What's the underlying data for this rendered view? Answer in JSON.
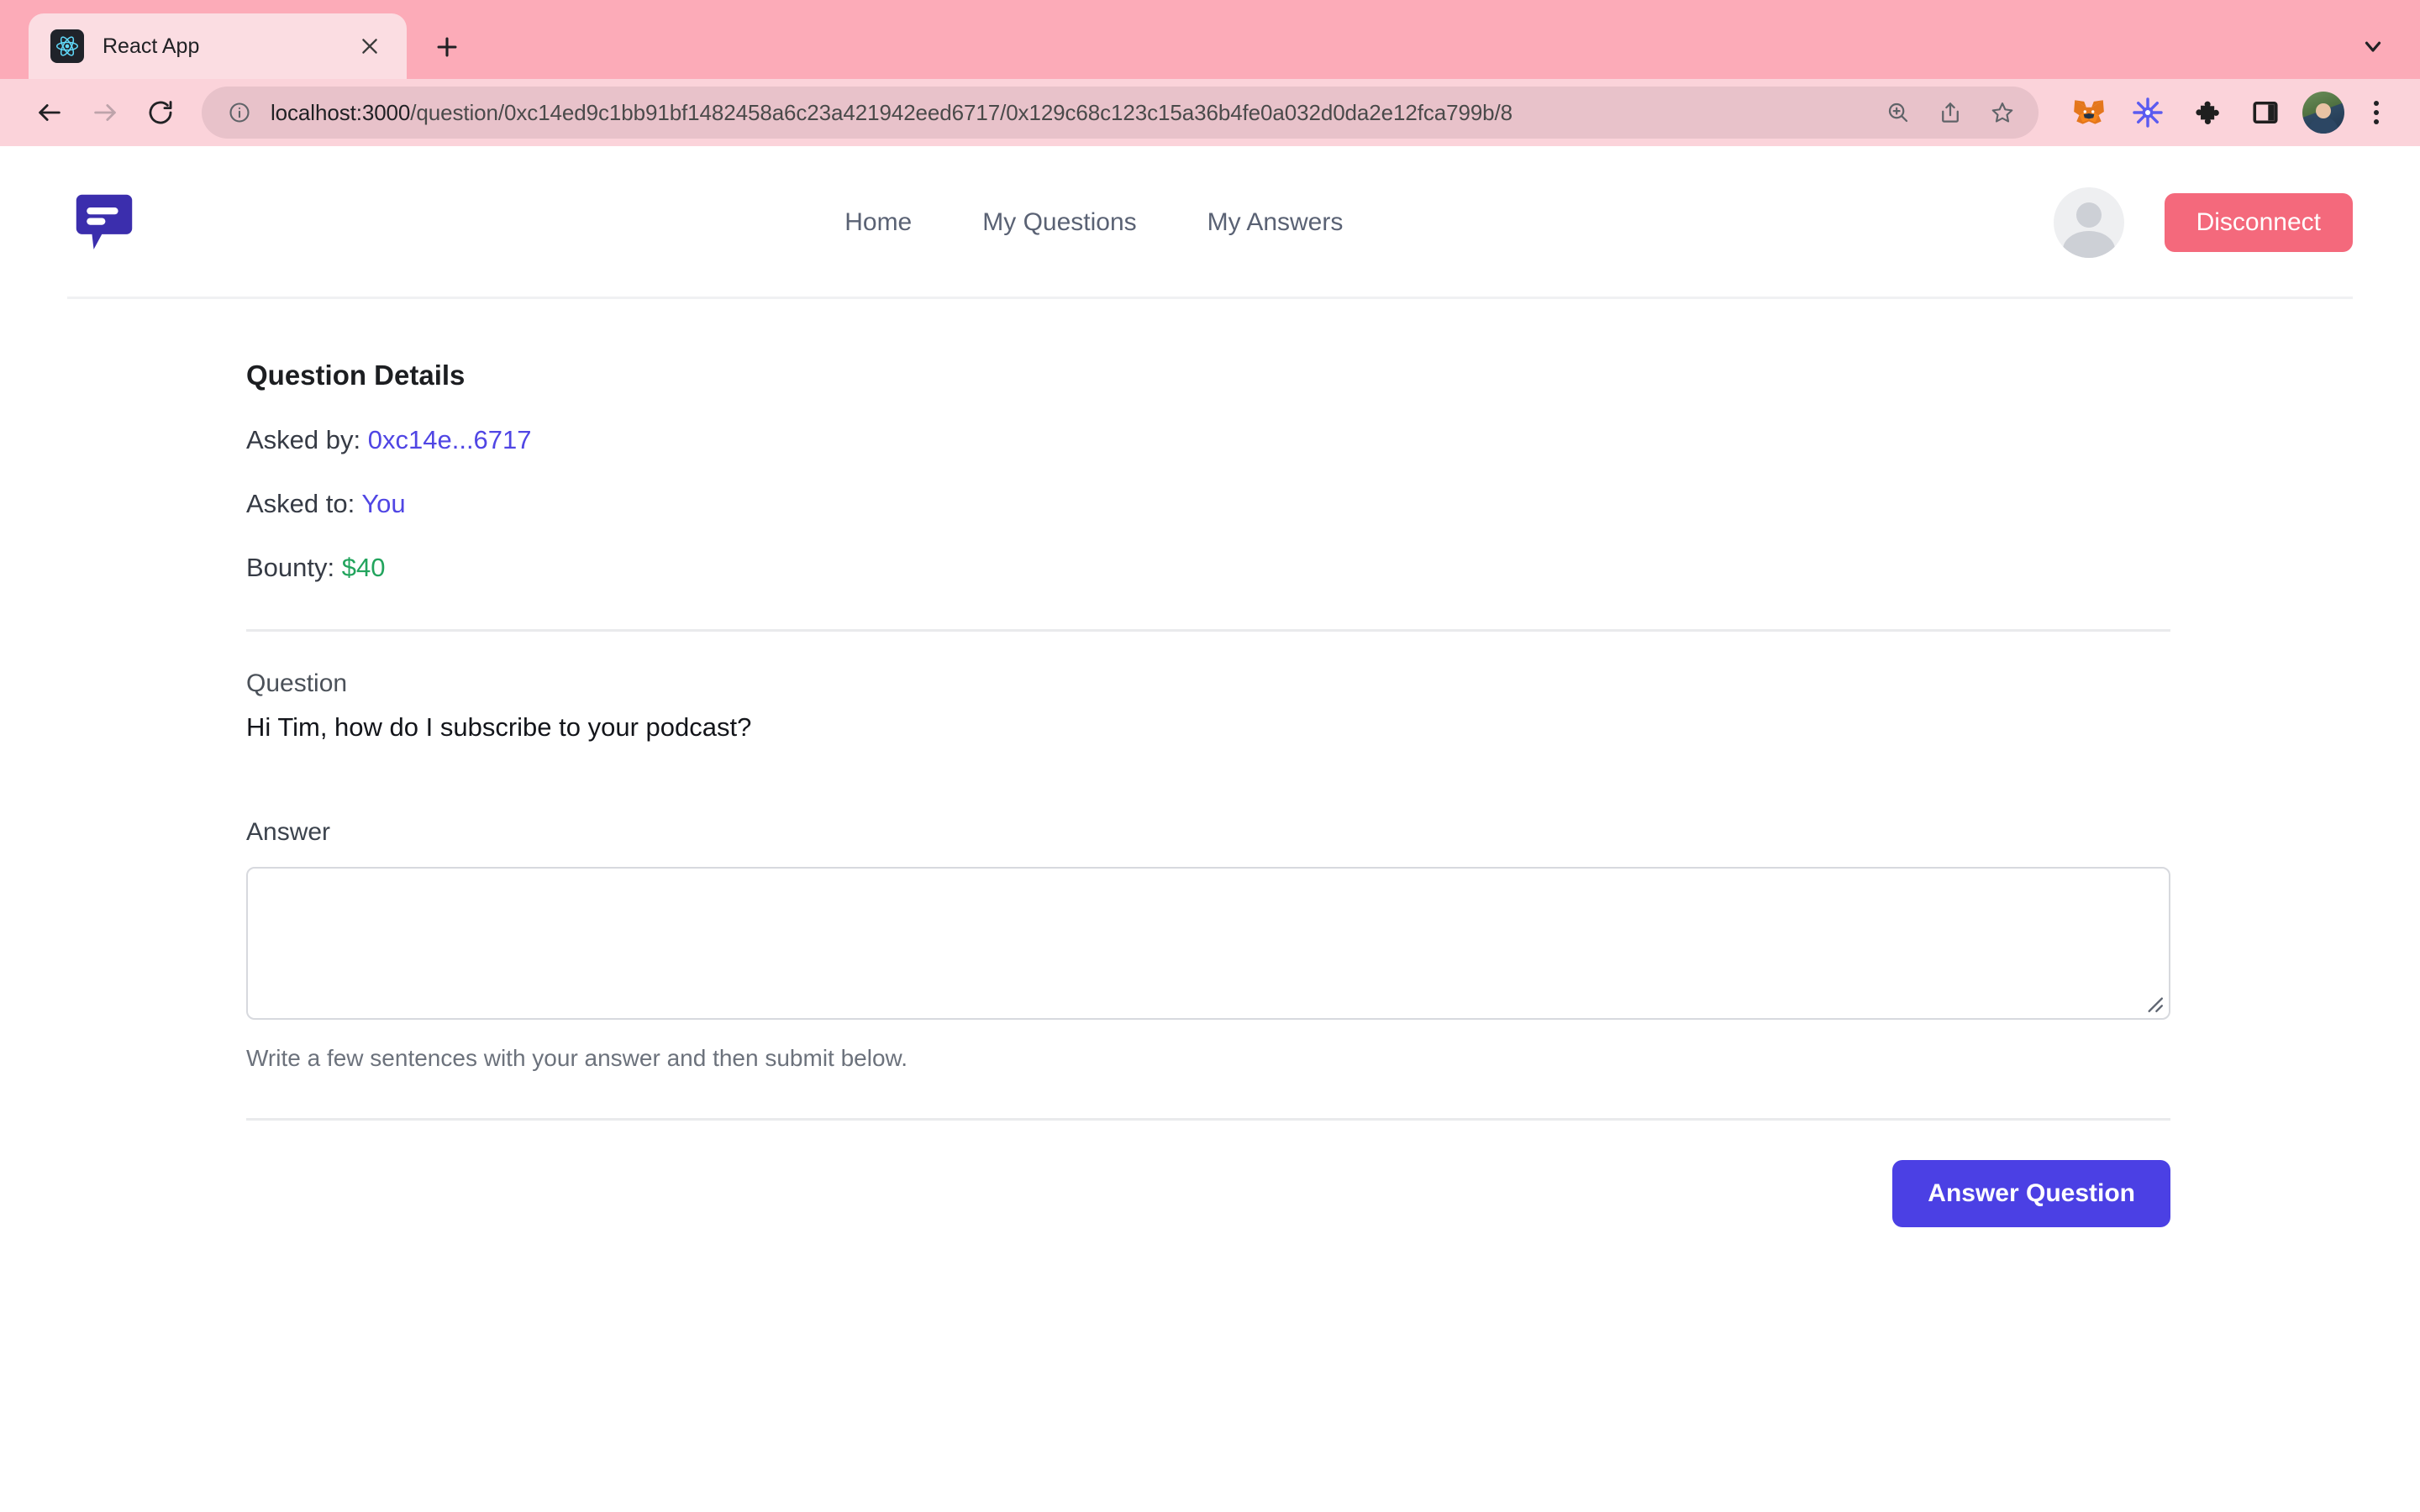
{
  "browser": {
    "tab": {
      "title": "React App",
      "favicon_icon": "react-logo-icon",
      "close_icon": "close-icon"
    },
    "new_tab_icon": "plus-icon",
    "tab_list_chevron_icon": "chevron-down-icon",
    "nav": {
      "back_icon": "arrow-left-icon",
      "forward_icon": "arrow-right-icon",
      "reload_icon": "reload-icon"
    },
    "omnibox": {
      "site_info_icon": "info-circle-icon",
      "url_host": "localhost:3000",
      "url_path": "/question/0xc14ed9c1bb91bf1482458a6c23a421942eed6717/0x129c68c123c15a36b4fe0a032d0da2e12fca799b/8",
      "zoom_icon": "zoom-search-icon",
      "share_icon": "share-icon",
      "bookmark_icon": "star-icon"
    },
    "extensions": [
      {
        "name": "metamask-extension-icon"
      },
      {
        "name": "starburst-extension-icon"
      },
      {
        "name": "puzzle-extensions-icon"
      },
      {
        "name": "side-panel-icon"
      }
    ],
    "profile_icon": "profile-avatar-icon",
    "menu_icon": "kebab-menu-icon"
  },
  "app": {
    "logo_icon": "speech-bubble-logo-icon",
    "nav": [
      {
        "label": "Home"
      },
      {
        "label": "My Questions"
      },
      {
        "label": "My Answers"
      }
    ],
    "avatar_icon": "user-avatar-icon",
    "disconnect_label": "Disconnect"
  },
  "details": {
    "title": "Question Details",
    "asked_by_label": "Asked by:",
    "asked_by_value": "0xc14e...6717",
    "asked_to_label": "Asked to:",
    "asked_to_value": "You",
    "bounty_label": "Bounty:",
    "bounty_value": "$40"
  },
  "question": {
    "label": "Question",
    "text": "Hi Tim, how do I subscribe to your podcast?"
  },
  "answer": {
    "label": "Answer",
    "value": "",
    "placeholder": "",
    "helper_text": "Write a few sentences with your answer and then submit below.",
    "submit_label": "Answer Question"
  },
  "colors": {
    "accent_purple": "#4B40E4",
    "link_purple": "#5046E4",
    "bounty_green": "#22A45D",
    "disconnect_pink": "#F4697C",
    "chrome_pink": "#FCABB8",
    "toolbar_pink": "#FBD3DA"
  }
}
